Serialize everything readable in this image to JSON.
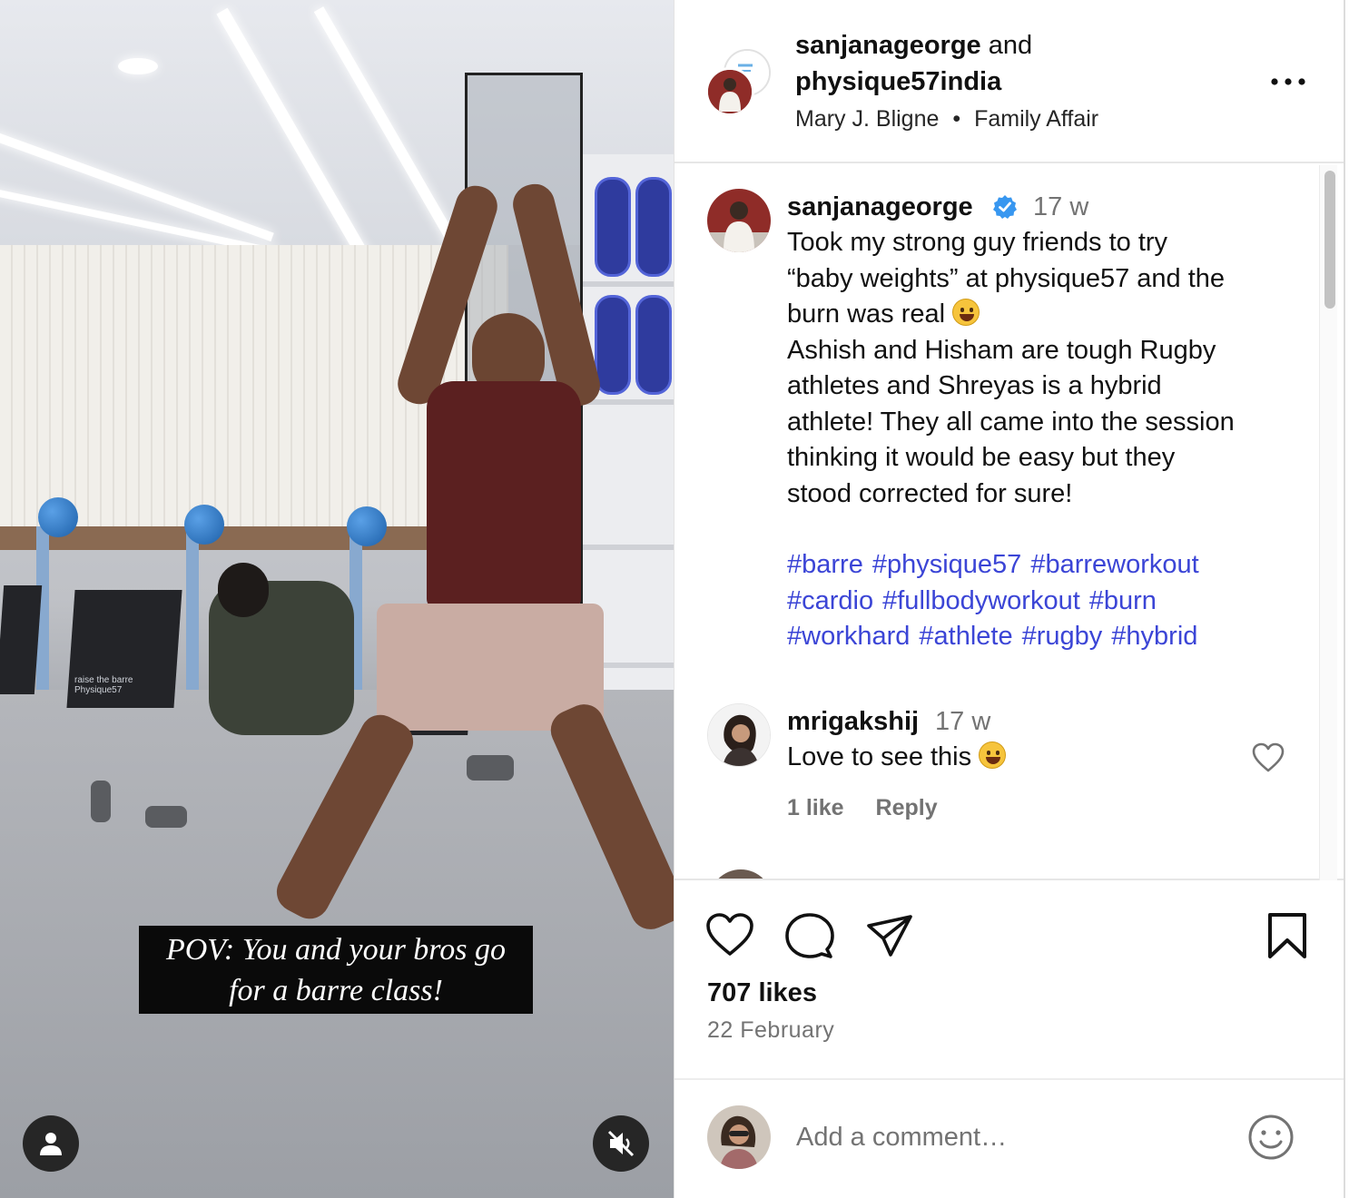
{
  "post": {
    "header": {
      "author": "sanjanageorge",
      "joiner": "and",
      "collaborator": "physique57india",
      "audio_artist": "Mary J. Bligne",
      "audio_separator": "•",
      "audio_track": "Family Affair"
    },
    "media": {
      "overlay_line1": "POV: You and your bros go",
      "overlay_line2": "for a barre class!",
      "mat_label_1": "raise the barre",
      "mat_label_2": "Physique57",
      "tag_button_icon": "user-icon",
      "mute_button_icon": "speaker-muted-icon"
    },
    "caption": {
      "username": "sanjanageorge",
      "verified": true,
      "time": "17 w",
      "lines": [
        "Took my strong guy friends to try",
        "“baby weights” at physique57 and the",
        "burn was real",
        "Ashish and Hisham are tough Rugby",
        "athletes and Shreyas is a hybrid",
        "athlete! They all came into the session",
        "thinking it would be easy but they",
        "stood corrected for sure!"
      ],
      "hashtag_lines": [
        [
          "#barre",
          "#physique57",
          "#barreworkout"
        ],
        [
          "#cardio",
          "#fullbodyworkout",
          "#burn"
        ],
        [
          "#workhard",
          "#athlete",
          "#rugby",
          "#hybrid"
        ]
      ]
    },
    "comments": [
      {
        "username": "mrigakshij",
        "time": "17 w",
        "text": "Love to see this",
        "likes_label": "1 like",
        "reply_label": "Reply"
      }
    ],
    "likes": "707 likes",
    "date": "22 February",
    "add_comment_placeholder": "Add a comment…"
  },
  "colors": {
    "link": "#3b45d6",
    "verified": "#3897f0",
    "muted_text": "#737373"
  }
}
